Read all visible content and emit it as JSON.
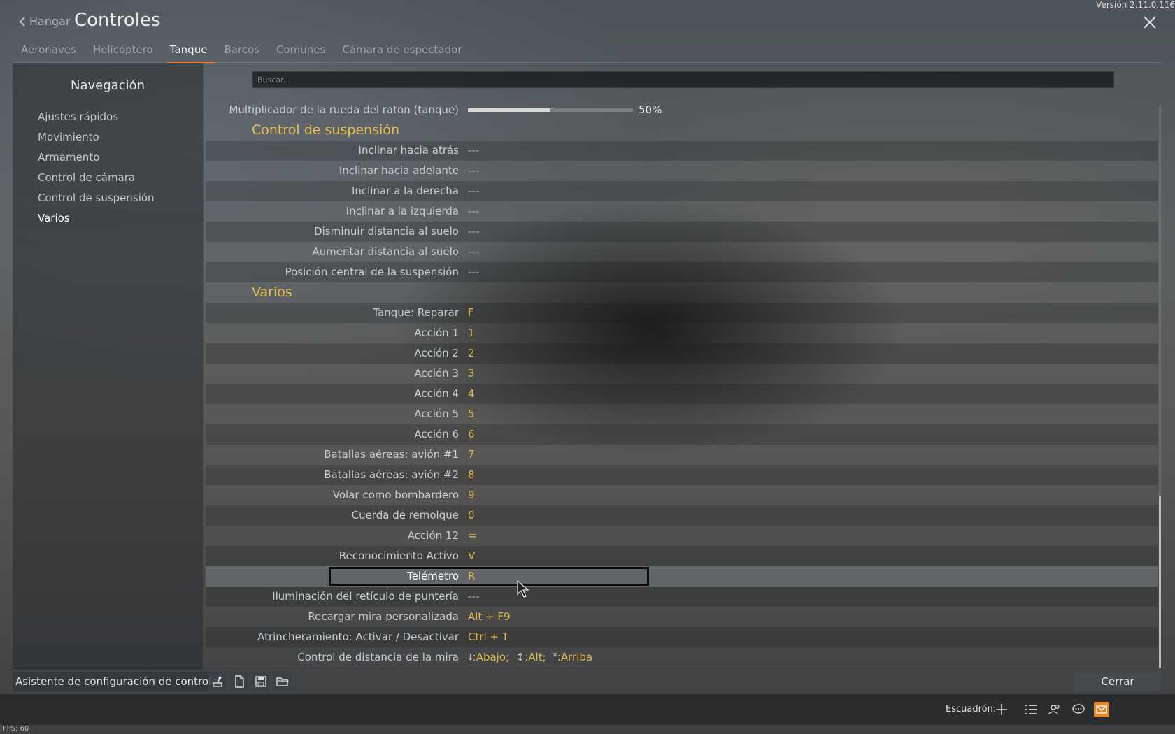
{
  "header": {
    "version": "Versión 2.11.0.116",
    "back_label": "Hangar",
    "separator": "|",
    "title": "Controles"
  },
  "tabs": [
    {
      "label": "Aeronaves",
      "active": false
    },
    {
      "label": "Helicóptero",
      "active": false
    },
    {
      "label": "Tanque",
      "active": true
    },
    {
      "label": "Barcos",
      "active": false
    },
    {
      "label": "Comunes",
      "active": false
    },
    {
      "label": "Cámara de espectador",
      "active": false
    }
  ],
  "sidebar": {
    "title": "Navegación",
    "items": [
      {
        "label": "Ajustes rápidos"
      },
      {
        "label": "Movimiento"
      },
      {
        "label": "Armamento"
      },
      {
        "label": "Control de cámara"
      },
      {
        "label": "Control de suspensión"
      },
      {
        "label": "Varios",
        "active": true
      }
    ]
  },
  "search": {
    "placeholder": "Buscar..."
  },
  "slider_setting": {
    "label": "Multiplicador de la rueda del raton (tanque)",
    "value_text": "50%",
    "value": 50
  },
  "sections": {
    "suspension": {
      "title": "Control de suspensión",
      "rows": [
        {
          "label": "Inclinar hacia atrás",
          "value": "---"
        },
        {
          "label": "Inclinar hacia adelante",
          "value": "---"
        },
        {
          "label": "Inclinar a la derecha",
          "value": "---"
        },
        {
          "label": "Inclinar a la izquierda",
          "value": "---"
        },
        {
          "label": "Disminuir distancia al suelo",
          "value": "---"
        },
        {
          "label": "Aumentar distancia al suelo",
          "value": "---"
        },
        {
          "label": "Posición central de la suspensión",
          "value": "---"
        }
      ]
    },
    "varios": {
      "title": "Varios",
      "rows": [
        {
          "label": "Tanque: Reparar",
          "value": "F"
        },
        {
          "label": "Acción 1",
          "value": "1"
        },
        {
          "label": "Acción 2",
          "value": "2"
        },
        {
          "label": "Acción 3",
          "value": "3"
        },
        {
          "label": "Acción 4",
          "value": "4"
        },
        {
          "label": "Acción 5",
          "value": "5"
        },
        {
          "label": "Acción 6",
          "value": "6"
        },
        {
          "label": "Batallas aéreas: avión #1",
          "value": "7"
        },
        {
          "label": "Batallas aéreas: avión #2",
          "value": "8"
        },
        {
          "label": "Volar como bombardero",
          "value": "9"
        },
        {
          "label": "Cuerda de remolque",
          "value": "0"
        },
        {
          "label": "Acción 12",
          "value": "="
        },
        {
          "label": "Reconocimiento Activo",
          "value": "V"
        },
        {
          "label": "Telémetro",
          "value": "R",
          "highlighted": true
        },
        {
          "label": "Iluminación del retículo de puntería",
          "value": "---"
        },
        {
          "label": "Recargar mira personalizada",
          "value": "Alt + F9"
        },
        {
          "label": "Atrincheramiento: Activar / Desactivar",
          "value": "Ctrl + T"
        },
        {
          "label": "Control de distancia de la mira",
          "value": "",
          "axis": {
            "down": "Abajo;",
            "alt": "Alt;",
            "up": "Arriba"
          }
        }
      ]
    }
  },
  "bottom": {
    "wizard_label": "Asistente de configuración de controles",
    "close_label": "Cerrar"
  },
  "footer": {
    "squad_label": "Escuadrón:",
    "fps": "FPS: 60"
  },
  "colors": {
    "accent": "#e36b1f",
    "binding": "#e0b84a",
    "section": "#e8bf50"
  }
}
